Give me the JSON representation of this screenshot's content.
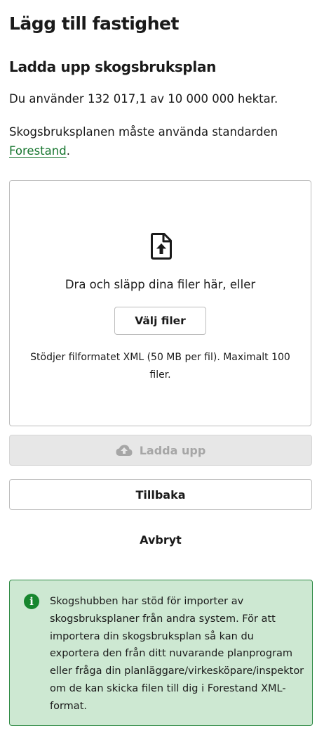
{
  "page": {
    "title": "Lägg till fastighet"
  },
  "upload_section": {
    "title": "Ladda upp skogsbruksplan",
    "usage_text": "Du använder 132 017,1 av 10 000 000 hektar.",
    "standard_text": "Skogsbruksplanen måste använda standarden",
    "standard_link": "Forestand",
    "standard_suffix": "."
  },
  "dropzone": {
    "icon": "file-upload-icon",
    "drop_text": "Dra och släpp dina filer här, eller",
    "choose_button": "Välj filer",
    "format_text": "Stödjer filformatet XML (50 MB per fil). Maximalt 100 filer."
  },
  "actions": {
    "upload_icon": "cloud-upload-icon",
    "upload_button": "Ladda upp",
    "upload_disabled": true,
    "back_button": "Tillbaka",
    "cancel_button": "Avbryt"
  },
  "info": {
    "icon": "info-icon",
    "icon_glyph": "i",
    "text": "Skogshubben har stöd för importer av skogsbruksplaner från andra system. För att importera din skogsbruksplan så kan du exportera den från ditt nuvarande planprogram eller fråga din planläggare/virkesköpare/inspektor om de kan skicka filen till dig i Forestand XML-format."
  },
  "colors": {
    "link": "#17762f",
    "info_background": "#cde8d2",
    "info_border": "#2e8a44",
    "info_icon": "#17862e",
    "disabled_button": "#e7e7e7",
    "disabled_text": "#a6a6a6"
  }
}
